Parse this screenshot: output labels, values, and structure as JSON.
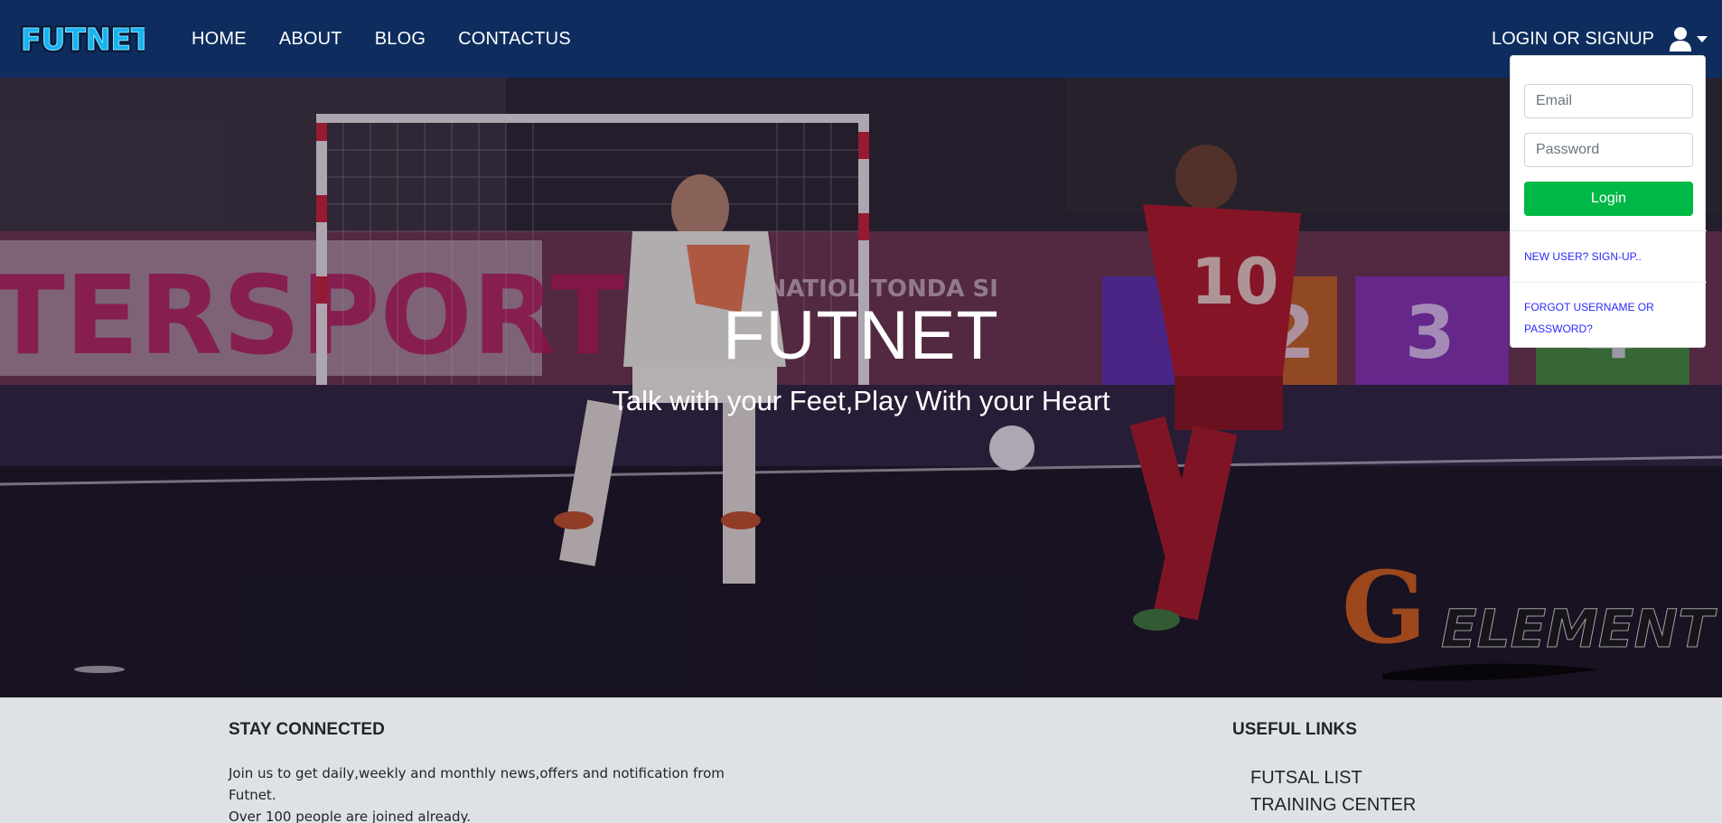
{
  "brand": {
    "name": "FUTNET"
  },
  "nav": {
    "items": [
      "HOME",
      "ABOUT",
      "BLOG",
      "CONTACTUS"
    ],
    "login_label": "LOGIN OR SIGNUP"
  },
  "hero": {
    "title": "FUTNET",
    "tagline": "Talk with your Feet,Play With your Heart",
    "background_banner_text": "TERSPORT",
    "background_board_text": "ASINATIOLITONDA SI",
    "jersey_number": "10",
    "board_numbers": [
      "2",
      "3",
      "4"
    ],
    "watermark": "ELEMENT",
    "watermark_letter": "G"
  },
  "login": {
    "email_placeholder": "Email",
    "password_placeholder": "Password",
    "button_label": "Login",
    "signup_link": "NEW USER? SIGN-UP..",
    "forgot_link": "FORGOT USERNAME OR PASSWORD?"
  },
  "footer": {
    "stay_connected": {
      "title": "STAY CONNECTED",
      "text_1": "Join us to get daily,weekly and monthly news,offers and notification from Futnet.",
      "text_2": "Over 100 people are joined already."
    },
    "useful_links": {
      "title": "USEFUL LINKS",
      "items": [
        "FUTSAL LIST",
        "TRAINING CENTER"
      ]
    }
  },
  "colors": {
    "navbar": "#0e2d5e",
    "login_button": "#00b845",
    "dropdown_link": "#2a2aff",
    "footer_bg": "#dee2e6",
    "logo_fill": "#1ab3f0"
  },
  "icons": [
    "user-icon",
    "caret-down-icon"
  ]
}
